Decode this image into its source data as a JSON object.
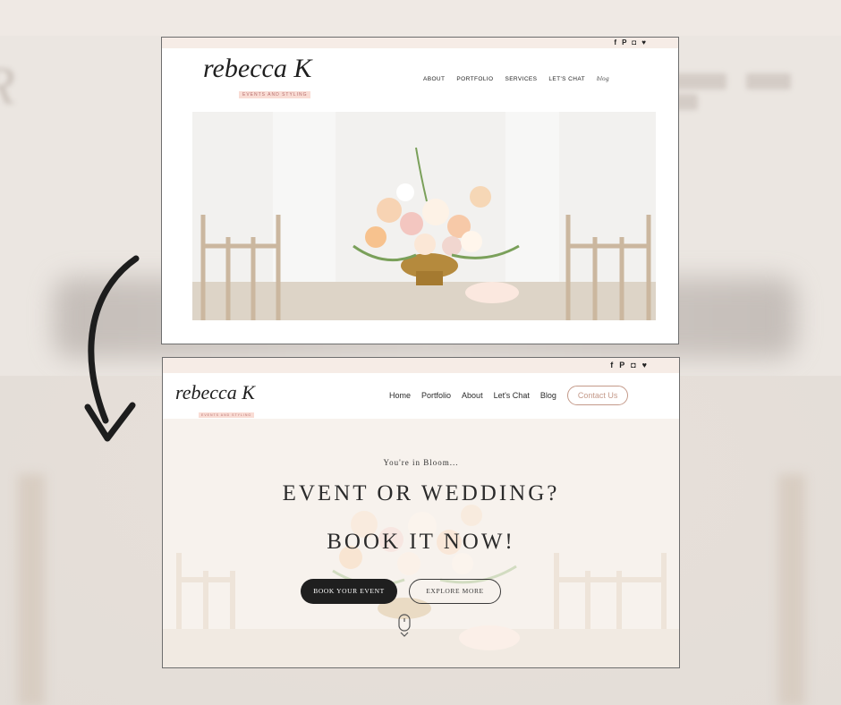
{
  "screenshot_before": {
    "social_icons": [
      "facebook-icon",
      "pinterest-icon",
      "instagram-icon",
      "twitter-icon"
    ],
    "social_glyphs": [
      "f",
      "P",
      "◘",
      "♥"
    ],
    "logo_script": "rebecca K",
    "logo_tagline": "EVENTS AND STYLING",
    "nav": [
      "ABOUT",
      "PORTFOLIO",
      "SERVICES",
      "LET'S CHAT",
      "blog"
    ]
  },
  "screenshot_after": {
    "social_icons": [
      "facebook-icon",
      "pinterest-icon",
      "instagram-icon",
      "twitter-icon"
    ],
    "social_glyphs": [
      "f",
      "P",
      "◘",
      "♥"
    ],
    "logo_script": "rebecca K",
    "logo_tagline": "EVENTS AND STYLING",
    "nav": [
      "Home",
      "Portfolio",
      "About",
      "Let's Chat",
      "Blog"
    ],
    "cta": "Contact Us",
    "hero": {
      "pre_title": "You're in Bloom...",
      "title_line1": "EVENT OR WEDDING?",
      "title_line2": "BOOK IT NOW!",
      "primary_button": "BOOK YOUR EVENT",
      "secondary_button": "EXPLORE MORE"
    }
  },
  "colors": {
    "topbar": "#f6ece6",
    "accent_pink": "#f9dcd4",
    "cta_border": "#c49a8a",
    "dark_button": "#1f1f1f"
  }
}
